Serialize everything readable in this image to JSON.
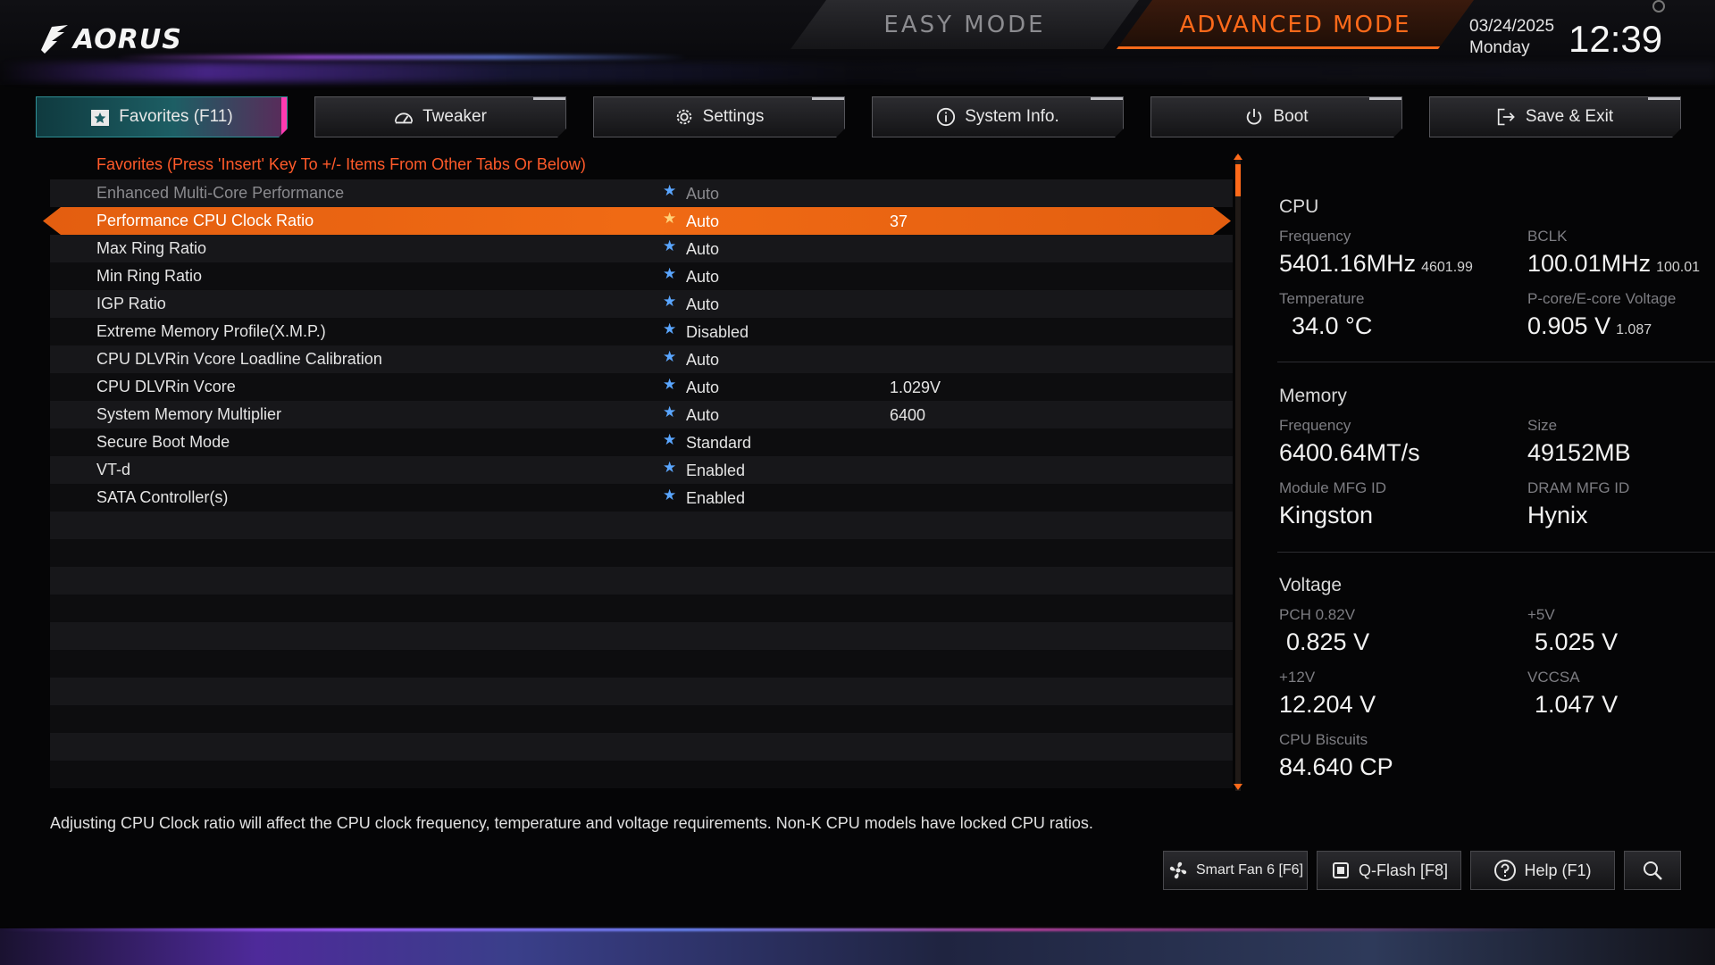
{
  "header": {
    "brand": "AORUS",
    "easy_mode": "EASY MODE",
    "advanced_mode": "ADVANCED MODE",
    "date": "03/24/2025",
    "weekday": "Monday",
    "time": "12:39"
  },
  "tabs": [
    {
      "label": "Favorites (F11)",
      "icon": "star-icon",
      "active": true
    },
    {
      "label": "Tweaker",
      "icon": "gauge-icon"
    },
    {
      "label": "Settings",
      "icon": "gear-icon"
    },
    {
      "label": "System Info.",
      "icon": "info-icon"
    },
    {
      "label": "Boot",
      "icon": "power-icon"
    },
    {
      "label": "Save & Exit",
      "icon": "exit-icon"
    }
  ],
  "favorites": {
    "header": "Favorites (Press 'Insert' Key To +/- Items From Other Tabs Or Below)",
    "items": [
      {
        "name": "Enhanced Multi-Core Performance",
        "value": "Auto",
        "current": ""
      },
      {
        "name": "Performance CPU Clock Ratio",
        "value": "Auto",
        "current": "37"
      },
      {
        "name": "Max Ring Ratio",
        "value": "Auto",
        "current": ""
      },
      {
        "name": "Min Ring Ratio",
        "value": "Auto",
        "current": ""
      },
      {
        "name": "IGP Ratio",
        "value": "Auto",
        "current": ""
      },
      {
        "name": "Extreme Memory Profile(X.M.P.)",
        "value": "Disabled",
        "current": ""
      },
      {
        "name": "CPU DLVRin Vcore Loadline Calibration",
        "value": "Auto",
        "current": ""
      },
      {
        "name": "CPU DLVRin Vcore",
        "value": "Auto",
        "current": "1.029V"
      },
      {
        "name": "System Memory Multiplier",
        "value": "Auto",
        "current": "6400"
      },
      {
        "name": "Secure Boot Mode",
        "value": "Standard",
        "current": ""
      },
      {
        "name": "VT-d",
        "value": "Enabled",
        "current": ""
      },
      {
        "name": "SATA Controller(s)",
        "value": "Enabled",
        "current": ""
      }
    ]
  },
  "cpu": {
    "title": "CPU",
    "freq_label": "Frequency",
    "freq": "5401.16MHz",
    "freq_sub": "4601.99",
    "bclk_label": "BCLK",
    "bclk": "100.01MHz",
    "bclk_sub": "100.01",
    "temp_label": "Temperature",
    "temp": "34.0 °C",
    "volt_label": "P-core/E-core Voltage",
    "volt": "0.905 V",
    "volt_sub": "1.087"
  },
  "memory": {
    "title": "Memory",
    "freq_label": "Frequency",
    "freq": "6400.64MT/s",
    "size_label": "Size",
    "size": "49152MB",
    "module_label": "Module MFG ID",
    "module": "Kingston",
    "dram_label": "DRAM MFG ID",
    "dram": "Hynix"
  },
  "voltage": {
    "title": "Voltage",
    "pch_label": "PCH 0.82V",
    "pch": "0.825 V",
    "v5_label": "+5V",
    "v5": "5.025 V",
    "v12_label": "+12V",
    "v12": "12.204 V",
    "vccsa_label": "VCCSA",
    "vccsa": "1.047 V",
    "biscuits_label": "CPU Biscuits",
    "biscuits": "84.640 CP"
  },
  "description": "Adjusting CPU Clock ratio will affect the CPU clock frequency, temperature and voltage requirements. Non-K CPU models have locked CPU ratios.",
  "bottom_buttons": {
    "smart_fan": "Smart Fan 6 [F6]",
    "qflash": "Q-Flash [F8]",
    "help": "Help (F1)"
  },
  "colors": {
    "accent": "#ff6a1a",
    "favorite_star": "#5aa6ff",
    "active_tab": "#1d5e64"
  }
}
